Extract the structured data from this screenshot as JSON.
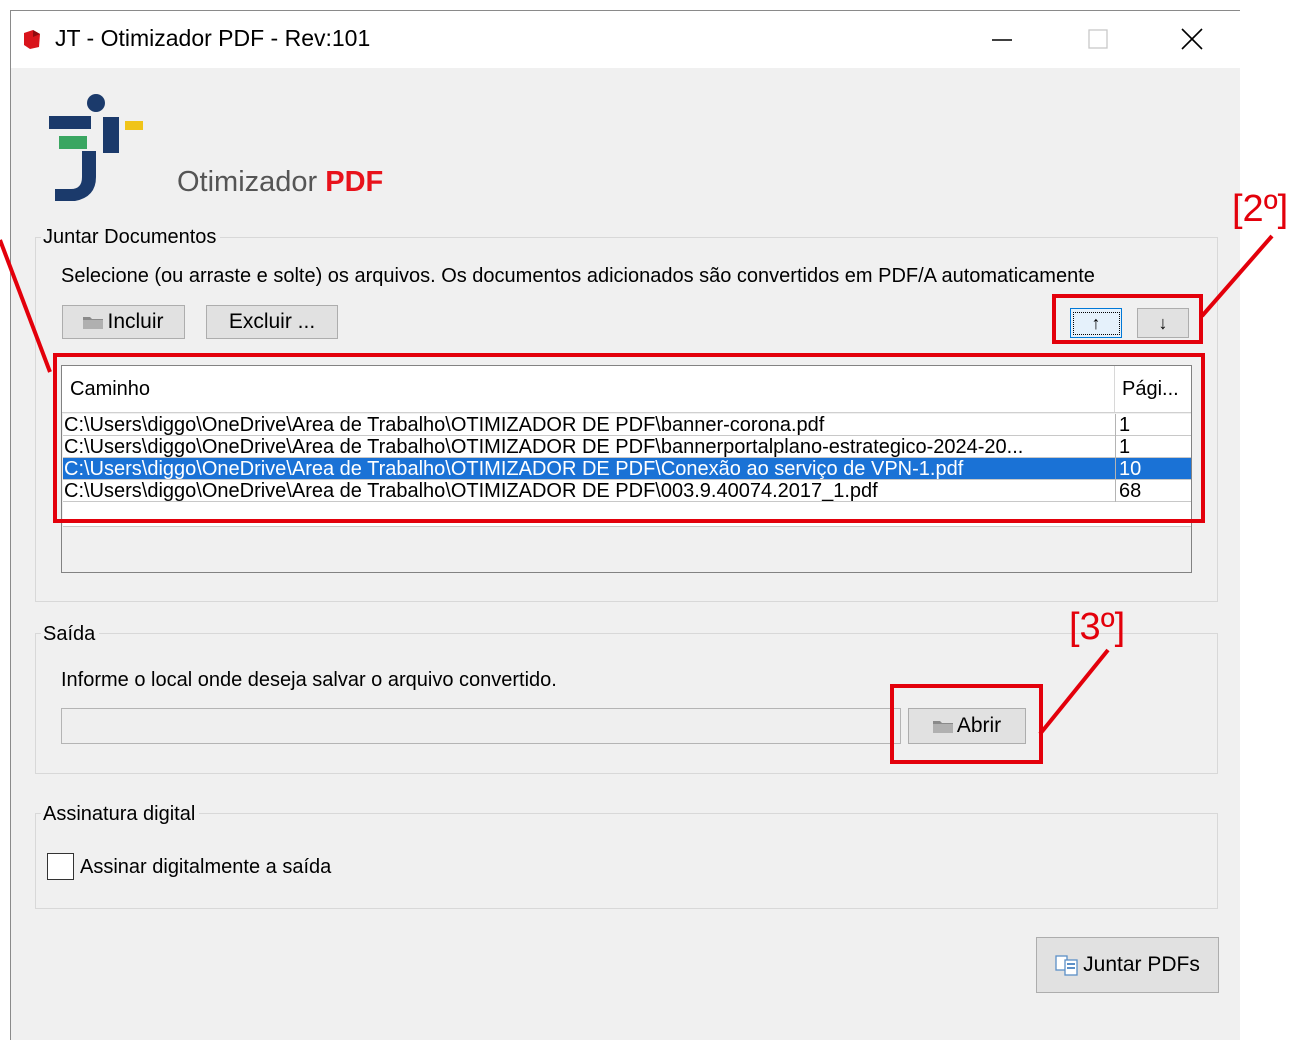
{
  "window": {
    "title": "JT - Otimizador PDF - Rev:101",
    "controls": [
      "minimize",
      "maximize",
      "close"
    ]
  },
  "header": {
    "label_prefix": "Otimizador",
    "label_accent": "PDF",
    "accent_color": "#e8121b"
  },
  "juntar": {
    "group_title": "Juntar Documentos",
    "description": "Selecione (ou arraste e solte) os arquivos. Os documentos adicionados são convertidos em PDF/A automaticamente",
    "incluir_label": "Incluir",
    "excluir_label": "Excluir ...",
    "up_label": "↑",
    "down_label": "↓",
    "table": {
      "col_path": "Caminho",
      "col_pages": "Pági...",
      "rows": [
        {
          "path": "C:\\Users\\diggo\\OneDrive\\Area de Trabalho\\OTIMIZADOR DE PDF\\banner-corona.pdf",
          "pages": "1"
        },
        {
          "path": "C:\\Users\\diggo\\OneDrive\\Area de Trabalho\\OTIMIZADOR DE PDF\\bannerportalplano-estrategico-2024-20...",
          "pages": "1"
        },
        {
          "path": "C:\\Users\\diggo\\OneDrive\\Area de Trabalho\\OTIMIZADOR DE PDF\\Conexão ao serviço de VPN-1.pdf",
          "pages": "10",
          "selected": true
        },
        {
          "path": "C:\\Users\\diggo\\OneDrive\\Area de Trabalho\\OTIMIZADOR DE PDF\\003.9.40074.2017_1.pdf",
          "pages": "68"
        }
      ],
      "selection_color": "#1a72d6"
    }
  },
  "saida": {
    "group_title": "Saída",
    "description": "Informe o local onde deseja salvar o arquivo convertido.",
    "path_value": "",
    "abrir_label": "Abrir"
  },
  "assinatura": {
    "group_title": "Assinatura digital",
    "checkbox_label": "Assinar digitalmente a saída",
    "checked": false
  },
  "juntar_pdfs_label": "Juntar PDFs",
  "annotations": {
    "label_2": "[2º]",
    "label_3": "[3º]",
    "color": "#e3000b"
  }
}
